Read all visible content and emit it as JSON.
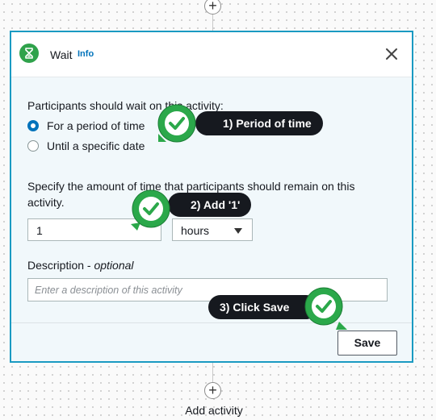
{
  "flow": {
    "top_plus": "+",
    "bottom_plus": "+",
    "add_activity_label": "Add activity"
  },
  "card": {
    "title": "Wait",
    "info_link": "Info",
    "close_icon": "close-icon",
    "wait_icon": "hourglass-icon",
    "accent_color": "#1a9ac2",
    "icon_color": "#2fa24b"
  },
  "wait_type": {
    "label": "Participants should wait on this activity:",
    "options": [
      {
        "label": "For a period of time",
        "selected": true
      },
      {
        "label": "Until a specific date",
        "selected": false
      }
    ]
  },
  "amount": {
    "label": "Specify the amount of time that participants should remain on this activity.",
    "value": "1",
    "unit": "hours"
  },
  "description": {
    "label": "Description - ",
    "optional": "optional",
    "placeholder": "Enter a description of this activity"
  },
  "save_label": "Save",
  "callouts": [
    {
      "text": "1) Period of time"
    },
    {
      "text": "2) Add '1'"
    },
    {
      "text": "3) Click Save"
    }
  ]
}
